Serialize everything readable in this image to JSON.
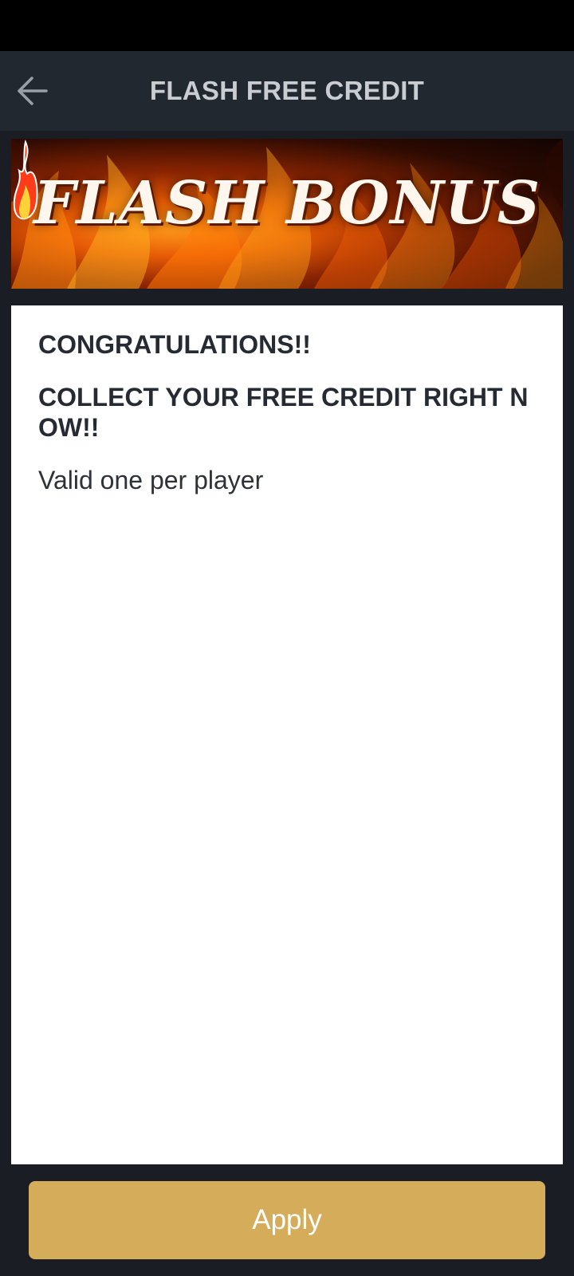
{
  "header": {
    "title": "FLASH FREE CREDIT",
    "back_icon": "arrow-left-icon"
  },
  "banner": {
    "text": "FLASH BONUS",
    "flame_icon": "flame-icon"
  },
  "content": {
    "line1": "CONGRATULATIONS!!",
    "line2": "COLLECT YOUR FREE CREDIT RIGHT NOW!!",
    "line3": "Valid one per player"
  },
  "footer": {
    "apply_label": "Apply"
  },
  "colors": {
    "background": "#1a1d24",
    "header": "#222830",
    "accent": "#d4ac5a",
    "text_dark": "#262b33"
  }
}
